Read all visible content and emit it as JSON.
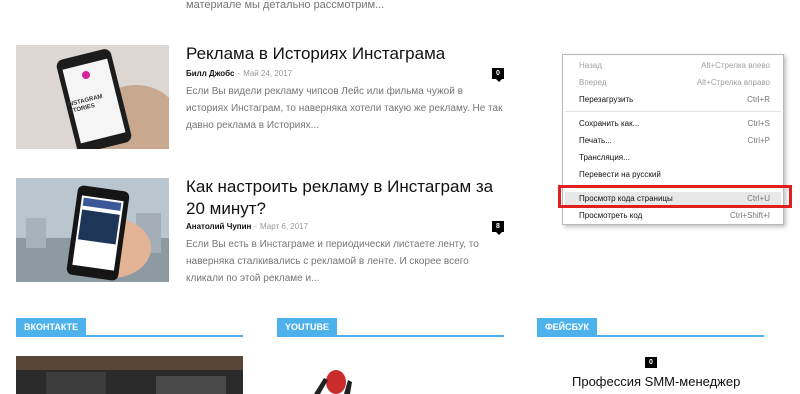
{
  "top_snippet": "материале мы детально рассмотрим...",
  "articles": [
    {
      "title": "Реклама в Историях Инстаграма",
      "author": "Билл Джобс",
      "date": "Май 24, 2017",
      "comments": "0",
      "excerpt": "Если Вы видели рекламу чипсов Лейс или фильма чужой в историях Инстаграм, то наверняка хотели такую же рекламу. Не так давно реклама в Историях...",
      "thumb_text": "INSTAGRAM STORIES"
    },
    {
      "title": "Как настроить рекламу в Инстаграм за 20 минут?",
      "author": "Анатолий Чупин",
      "date": "Март 6, 2017",
      "comments": "8",
      "excerpt": "Если Вы есть в Инстаграме и периодически листаете ленту, то наверняка сталкивались с рекламой в ленте. И скорее всего кликали по этой рекламе и..."
    }
  ],
  "blocks": [
    {
      "label": "ВКОНТАКТЕ"
    },
    {
      "label": "YOUTUBE"
    },
    {
      "label": "ФЕЙСБУК"
    }
  ],
  "facebook_post": {
    "comments": "0",
    "title": "Профессия SMM-менеджер"
  },
  "context_menu": {
    "items": [
      {
        "label": "Назад",
        "shortcut": "Alt+Стрелка влево",
        "disabled": true
      },
      {
        "label": "Вперед",
        "shortcut": "Alt+Стрелка вправо",
        "disabled": true
      },
      {
        "label": "Перезагрузить",
        "shortcut": "Ctrl+R",
        "disabled": false
      },
      {
        "label": "Сохранить как...",
        "shortcut": "Ctrl+S",
        "disabled": false
      },
      {
        "label": "Печать...",
        "shortcut": "Ctrl+P",
        "disabled": false
      },
      {
        "label": "Трансляция...",
        "shortcut": "",
        "disabled": false
      },
      {
        "label": "Перевести на русский",
        "shortcut": "",
        "disabled": false
      },
      {
        "label": "Просмотр кода страницы",
        "shortcut": "Ctrl+U",
        "disabled": false
      },
      {
        "label": "Просмотреть код",
        "shortcut": "Ctrl+Shift+I",
        "disabled": false
      }
    ]
  },
  "colors": {
    "accent": "#4db2ec",
    "highlight_border": "#e02020"
  }
}
